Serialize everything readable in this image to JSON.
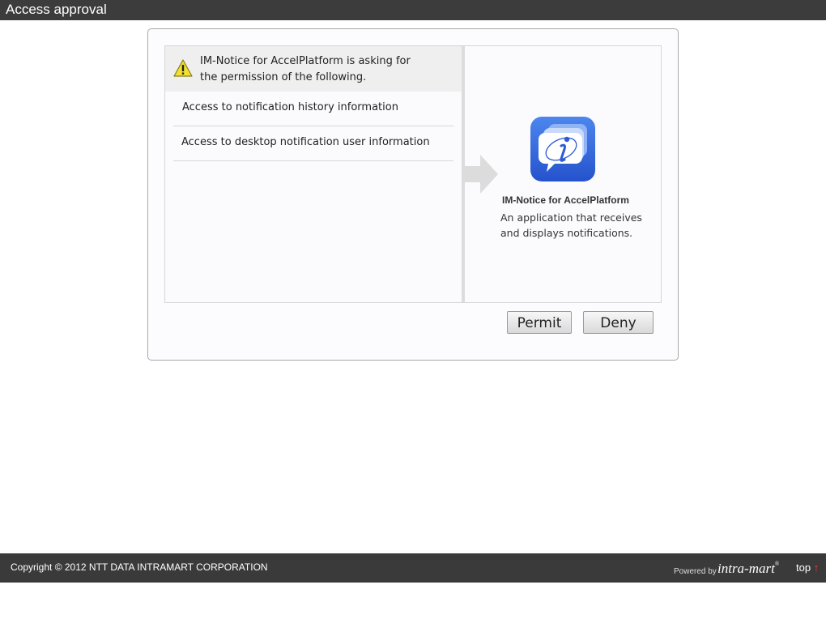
{
  "header": {
    "title": "Access approval"
  },
  "request": {
    "message_line1": "IM-Notice for AccelPlatform is asking for",
    "message_line2": "the permission of the following.",
    "permissions": [
      {
        "label": "Access to notification history information"
      },
      {
        "label": "Access to desktop notification user information"
      }
    ]
  },
  "app": {
    "name": "IM-Notice for AccelPlatform",
    "description": "An application that receives and displays notifications.",
    "icon": "chat-bubble-info-icon",
    "icon_color": "#3b6fe0"
  },
  "actions": {
    "permit_label": "Permit",
    "deny_label": "Deny"
  },
  "footer": {
    "copyright": "Copyright © 2012 NTT DATA INTRAMART CORPORATION",
    "powered_by": "Powered by",
    "logo_text": "intra-mart",
    "logo_reg": "®",
    "top_label": "top",
    "top_arrow": "↑"
  }
}
